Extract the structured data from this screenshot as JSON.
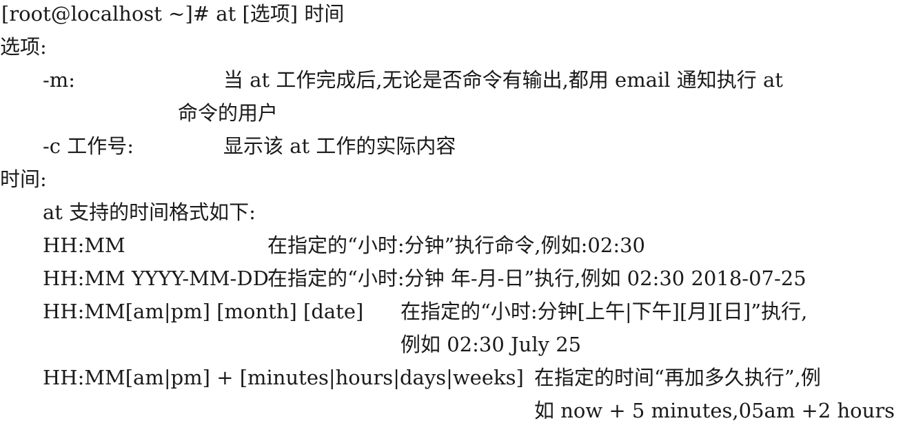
{
  "syntax_line": "[root@localhost ~]# at [选项] 时间",
  "options_heading": "选项:",
  "options": [
    {
      "flag": "-m:",
      "desc_line1": "当 at 工作完成后,无论是否命令有输出,都用 email 通知执行 at",
      "desc_line2": "命令的用户"
    },
    {
      "flag": "-c 工作号:",
      "desc_line1": "显示该 at 工作的实际内容"
    }
  ],
  "time_heading": "时间:",
  "time_intro": "at 支持的时间格式如下:",
  "formats": [
    {
      "format": "HH:MM",
      "desc_line1": "在指定的“小时:分钟”执行命令,例如:02:30"
    },
    {
      "format": "HH:MM YYYY-MM-DD",
      "desc_line1": "在指定的“小时:分钟 年-月-日”执行,例如 02:30 2018-07-25"
    },
    {
      "format": "HH:MM[am|pm] [month] [date]",
      "desc_line1": "在指定的“小时:分钟[上午|下午][月][日]”执行,",
      "desc_line2": "例如 02:30 July 25"
    },
    {
      "format": "HH:MM[am|pm] + [minutes|hours|days|weeks]",
      "desc_line1": "在指定的时间“再加多久执行”,例",
      "desc_line2": "如 now + 5 minutes,05am +2 hours"
    }
  ]
}
